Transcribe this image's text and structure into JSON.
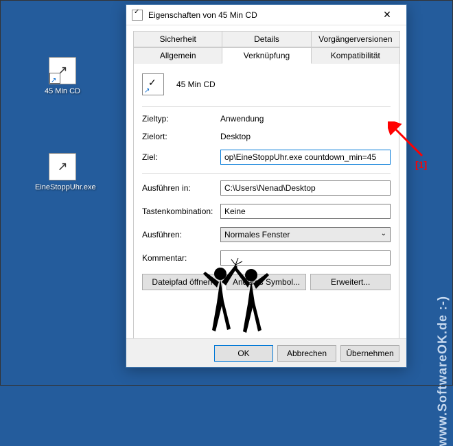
{
  "desktop": {
    "icons": [
      {
        "label": "45 Min CD"
      },
      {
        "label": "EineStoppUhr.exe"
      }
    ]
  },
  "dialog": {
    "title": "Eigenschaften von 45 Min CD",
    "tabs": {
      "row1": [
        "Sicherheit",
        "Details",
        "Vorgängerversionen"
      ],
      "row2": [
        "Allgemein",
        "Verknüpfung",
        "Kompatibilität"
      ],
      "active": "Verknüpfung"
    },
    "header_name": "45 Min CD",
    "rows": {
      "zieltyp_label": "Zieltyp:",
      "zieltyp_value": "Anwendung",
      "zielort_label": "Zielort:",
      "zielort_value": "Desktop",
      "ziel_label": "Ziel:",
      "ziel_value": "op\\EineStoppUhr.exe countdown_min=45",
      "ausfuehren_in_label": "Ausführen in:",
      "ausfuehren_in_value": "C:\\Users\\Nenad\\Desktop",
      "tasten_label": "Tastenkombination:",
      "tasten_value": "Keine",
      "ausfuehren_label": "Ausführen:",
      "ausfuehren_value": "Normales Fenster",
      "kommentar_label": "Kommentar:",
      "kommentar_value": ""
    },
    "buttons": {
      "dateipfad": "Dateipfad öffnen",
      "anderes_symbol": "Anderes Symbol...",
      "erweitert": "Erweitert...",
      "ok": "OK",
      "abbrechen": "Abbrechen",
      "uebernehmen": "Übernehmen"
    }
  },
  "annotation": {
    "marker": "[1]"
  },
  "watermark": "www.SoftwareOK.de :-)"
}
